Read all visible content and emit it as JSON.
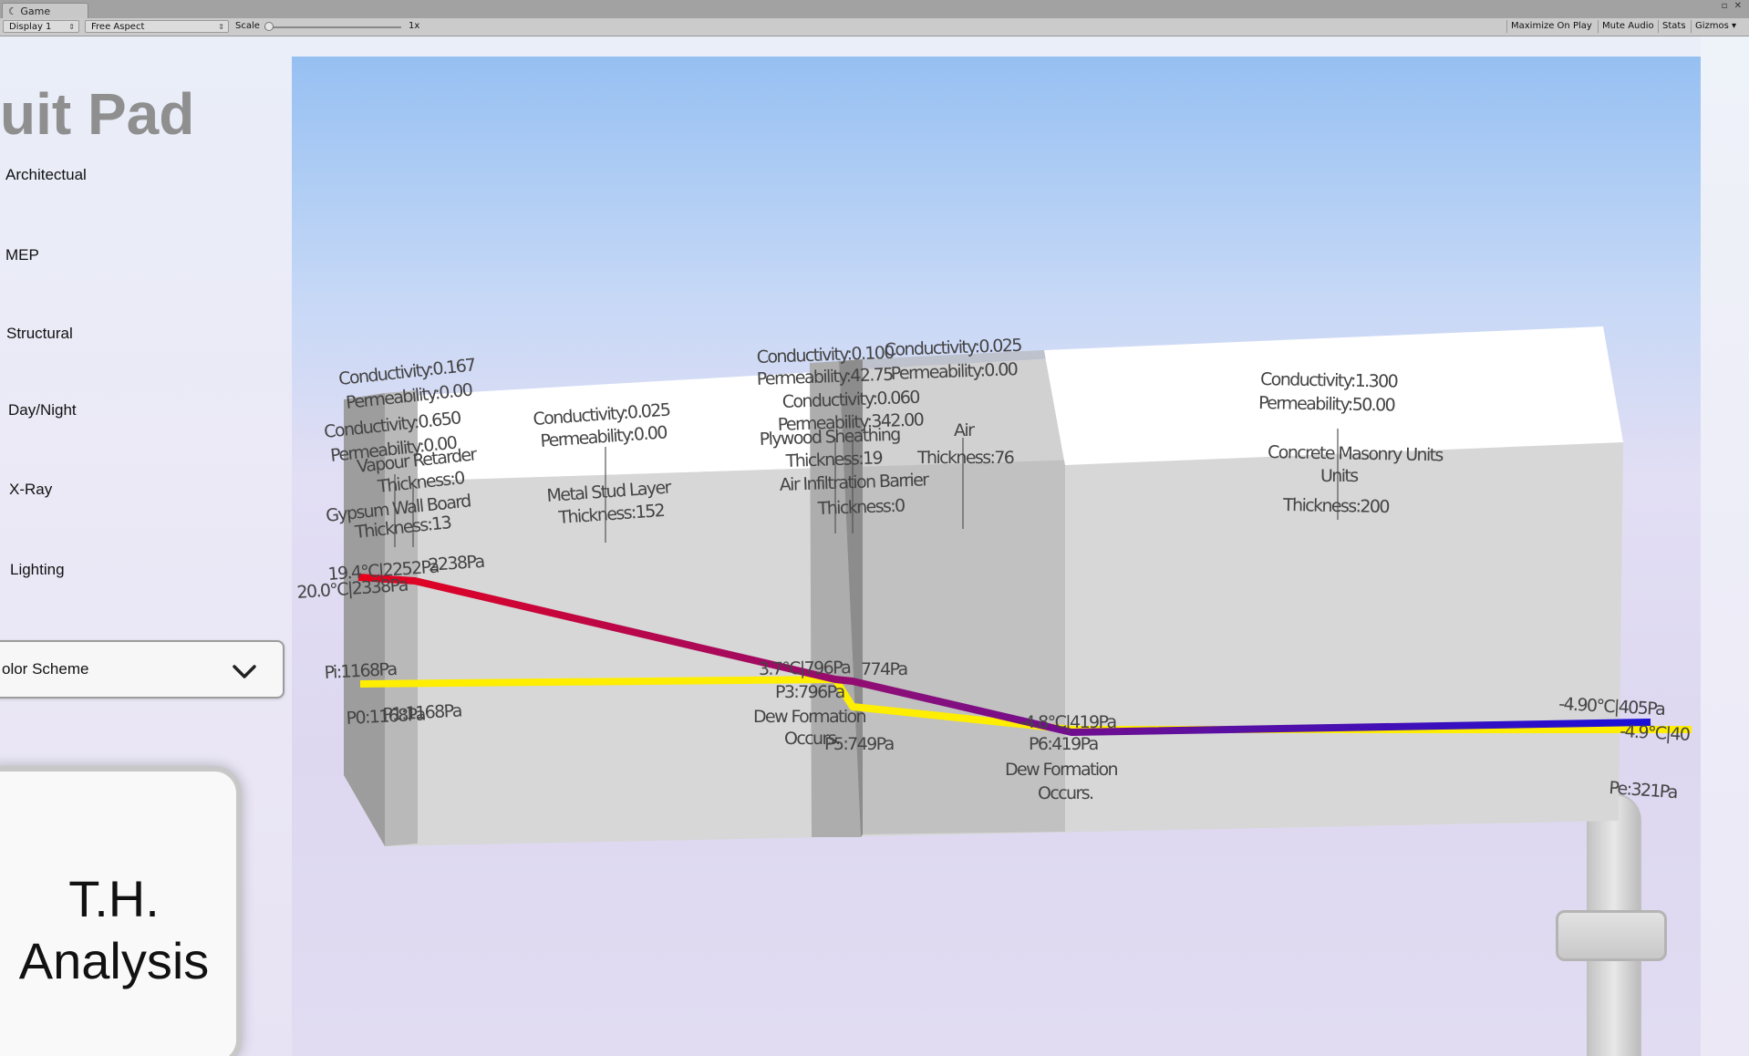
{
  "editor": {
    "tab_title": "Game",
    "display": "Display 1",
    "aspect": "Free Aspect",
    "scale_label": "Scale",
    "scale_value": "1x",
    "buttons": [
      "Maximize On Play",
      "Mute Audio",
      "Stats",
      "Gizmos"
    ]
  },
  "app": {
    "title": "uit Pad",
    "menu": [
      "Architectual",
      "MEP",
      "Structural",
      "Day/Night",
      "X-Ray",
      "Lighting"
    ],
    "color_scheme": "olor Scheme",
    "analysis_button": "T.H.\nAnalysis"
  },
  "colors": {
    "temperature_line_start": "#e8001a",
    "temperature_line_mid": "#8a0e7a",
    "temperature_line_end": "#1a10d8",
    "dewpoint_line": "#ffee00",
    "wall_face": "#d7d7d7",
    "wall_top": "#ffffff"
  },
  "wall": {
    "layers": [
      {
        "conductivity": "Conductivity:0.167",
        "permeability": "Permeability:0.00",
        "name": "Gypsum Wall Board",
        "thickness": "Thickness:13"
      },
      {
        "conductivity": "Conductivity:0.650",
        "permeability": "Permeability:0.00",
        "name": "Vapour Retarder",
        "thickness": "Thickness:0"
      },
      {
        "conductivity": "Conductivity:0.025",
        "permeability": "Permeability:0.00",
        "name": "Metal Stud Layer",
        "thickness": "Thickness:152"
      },
      {
        "conductivity": "Conductivity:0.100",
        "permeability": "Permeability:42.75",
        "name": "Plywood Sheathing",
        "thickness": "Thickness:19"
      },
      {
        "conductivity": "Conductivity:0.060",
        "permeability": "Permeability:342.00",
        "name": "Air Infiltration Barrier",
        "thickness": "Thickness:0"
      },
      {
        "conductivity": "Conductivity:0.025",
        "permeability": "Permeability:0.00",
        "name": "Air",
        "thickness": "Thickness:76"
      },
      {
        "conductivity": "Conductivity:1.300",
        "permeability": "Permeability:50.00",
        "name": "Concrete Masonry Units",
        "thickness": "Thickness:200"
      }
    ],
    "readings": {
      "t0": "20.0°C|2338Pa",
      "t1": "19.4°C|2252Pa",
      "t1b": "2238Pa",
      "pi": "Pi:1168Pa",
      "p0": "P0:1168Pa",
      "p1": "P1:1168Pa",
      "t3": "3.7°C|796Pa",
      "t3b": "774Pa",
      "p3": "P3:796Pa",
      "dew1": "Dew Formation",
      "dew1b": "Occurs.",
      "p5": "P5:749Pa",
      "t6": "-4.8°C|419Pa",
      "p6": "P6:419Pa",
      "dew2": "Dew Formation",
      "dew2b": "Occurs.",
      "te": "-4.90°C|405Pa",
      "te2": "-4.9°C|40",
      "pe": "Pe:321Pa"
    }
  }
}
